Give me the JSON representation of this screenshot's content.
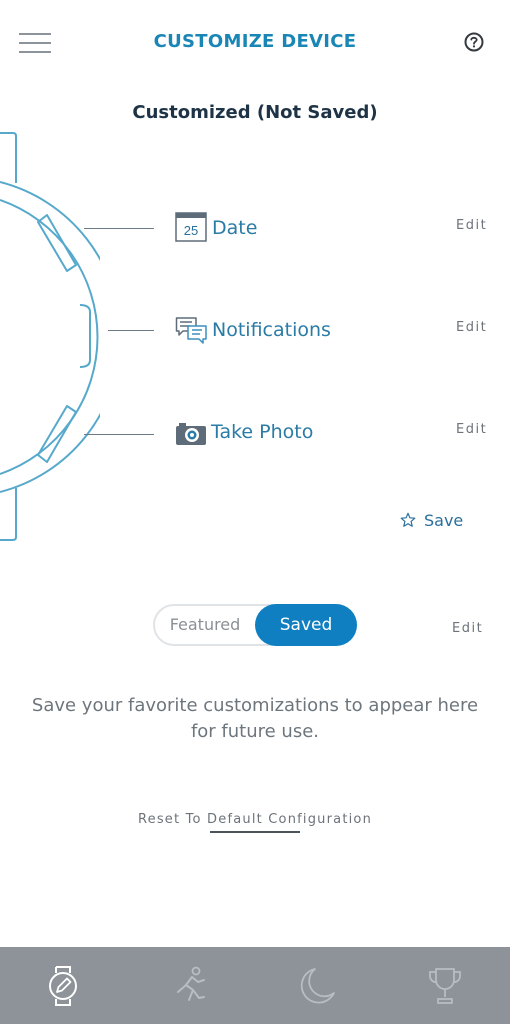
{
  "header": {
    "title": "CUSTOMIZE DEVICE",
    "menu_icon": "hamburger-icon",
    "help_icon": "question-mark-icon"
  },
  "subtitle": "Customized (Not Saved)",
  "rows": [
    {
      "label": "Date",
      "icon": "calendar-icon",
      "icon_text": "25",
      "edit": "Edit"
    },
    {
      "label": "Notifications",
      "icon": "chat-bubbles-icon",
      "edit": "Edit"
    },
    {
      "label": "Take Photo",
      "icon": "camera-icon",
      "edit": "Edit"
    }
  ],
  "save": {
    "label": "Save",
    "icon": "star-icon"
  },
  "toggle": {
    "options": [
      "Featured",
      "Saved"
    ],
    "selected": "Saved"
  },
  "toggle_edit": "Edit",
  "info_text": "Save your favorite customizations to appear here for future use.",
  "reset_link": "Reset To Default Configuration",
  "bottom_nav": [
    {
      "name": "watch-edit",
      "icon": "watch-edit-icon",
      "active": true
    },
    {
      "name": "activity",
      "icon": "runner-icon",
      "active": false
    },
    {
      "name": "sleep",
      "icon": "moon-icon",
      "active": false
    },
    {
      "name": "goals",
      "icon": "trophy-icon",
      "active": false
    }
  ],
  "colors": {
    "accent": "#1a86b6",
    "toggle_active": "#0f7fc1",
    "nav_bg": "#8d9398",
    "watch_outline": "#57a9cc"
  }
}
